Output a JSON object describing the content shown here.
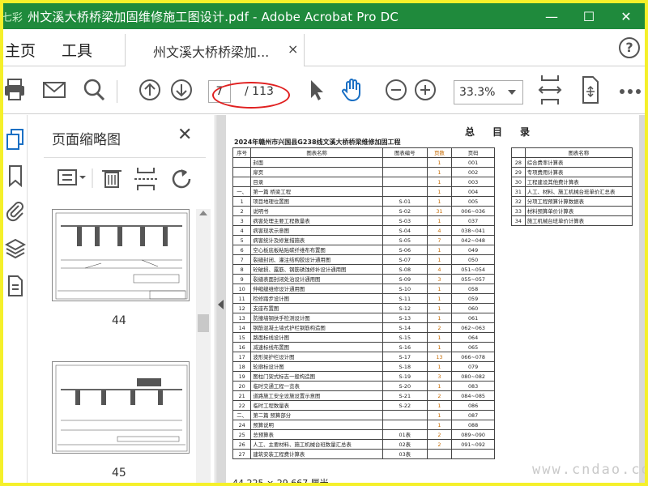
{
  "window": {
    "title": "州文溪大桥桥梁加固维修施工图设计.pdf - Adobe Acrobat Pro DC",
    "logo_text": "七彩",
    "controls": [
      "—",
      "☐",
      "✕"
    ]
  },
  "tabs": {
    "home": "主页",
    "tools": "工具",
    "document": "州文溪大桥桥梁加...",
    "document_close": "×",
    "help": "?"
  },
  "toolbar": {
    "current_page": "7",
    "total_pages": "/ 113",
    "zoom": "33.3%"
  },
  "thumbnails": {
    "title": "页面缩略图",
    "close": "✕",
    "pages": [
      {
        "label": "44"
      },
      {
        "label": "45"
      }
    ]
  },
  "document": {
    "title": "总目录",
    "subtitle": "2024年赣州市兴国县G238线文溪大桥桥梁维修加固工程",
    "left_headers": [
      "序号",
      "图表名称",
      "图表编号",
      "页数",
      "页码"
    ],
    "left_rows": [
      [
        "",
        "封面",
        "",
        "1",
        "001"
      ],
      [
        "",
        "扉页",
        "",
        "1",
        "002"
      ],
      [
        "",
        "目录",
        "",
        "1",
        "003"
      ],
      [
        "一、",
        "第一篇 桥梁工程",
        "",
        "1",
        "004"
      ],
      [
        "1",
        "项目地理位置图",
        "S-01",
        "1",
        "005"
      ],
      [
        "2",
        "说明书",
        "S-02",
        "31",
        "006~036"
      ],
      [
        "3",
        "病害处理主要工程数量表",
        "S-03",
        "1",
        "037"
      ],
      [
        "4",
        "病害现状示意图",
        "S-04",
        "4",
        "038~041"
      ],
      [
        "5",
        "病害统计及修复措施表",
        "S-05",
        "7",
        "042~048"
      ],
      [
        "6",
        "空心板底板粘贴碳纤维布布置图",
        "S-06",
        "1",
        "049"
      ],
      [
        "7",
        "裂缝封闭、灌注结构胶设计通用图",
        "S-07",
        "1",
        "050"
      ],
      [
        "8",
        "砼破损、露筋、钢筋锈蚀修补设计通用图",
        "S-08",
        "4",
        "051~054"
      ],
      [
        "9",
        "裂缝表面封闭处治设计通用图",
        "S-09",
        "3",
        "055~057"
      ],
      [
        "10",
        "伸缩缝维修设计通用图",
        "S-10",
        "1",
        "058"
      ],
      [
        "11",
        "检修踏步设计图",
        "S-11",
        "1",
        "059"
      ],
      [
        "12",
        "支座布置图",
        "S-12",
        "1",
        "060"
      ],
      [
        "13",
        "防撞墙钢扶手检测设计图",
        "S-13",
        "1",
        "061"
      ],
      [
        "14",
        "钢筋混凝土墙式护栏钢筋构造图",
        "S-14",
        "2",
        "062~063"
      ],
      [
        "15",
        "路面标线设计图",
        "S-15",
        "1",
        "064"
      ],
      [
        "16",
        "减速标线布置图",
        "S-16",
        "1",
        "065"
      ],
      [
        "17",
        "波形梁护栏设计图",
        "S-17",
        "13",
        "066~078"
      ],
      [
        "18",
        "轮廓标设计图",
        "S-18",
        "1",
        "079"
      ],
      [
        "19",
        "图柱门架式标志一般构造图",
        "S-19",
        "3",
        "080~082"
      ],
      [
        "20",
        "临时交通工程一览表",
        "S-20",
        "1",
        "083"
      ],
      [
        "21",
        "道路施工安全设施设置示意图",
        "S-21",
        "2",
        "084~085"
      ],
      [
        "22",
        "临时工程数量表",
        "S-22",
        "1",
        "086"
      ],
      [
        "二、",
        "第二篇 预算部分",
        "",
        "1",
        "087"
      ],
      [
        "24",
        "预算说明",
        "",
        "1",
        "088"
      ],
      [
        "25",
        "总预算表",
        "01表",
        "2",
        "089~090"
      ],
      [
        "26",
        "人工、主要材料、施工机械台班数量汇总表",
        "02表",
        "2",
        "091~092"
      ],
      [
        "27",
        "建筑安装工程费计算表",
        "03表",
        "",
        ""
      ]
    ],
    "right_headers": [
      "",
      "图表名称"
    ],
    "right_rows": [
      [
        "28",
        "综合费率计算表"
      ],
      [
        "29",
        "专项费用计算表"
      ],
      [
        "30",
        "工程建设其他费计算表"
      ],
      [
        "31",
        "人工、材料、施工机械台班单价汇总表"
      ],
      [
        "32",
        "分项工程预算计算数据表"
      ],
      [
        "33",
        "材料预算单价计算表"
      ],
      [
        "34",
        "施工机械台班单价计算表"
      ]
    ],
    "bottom_text": "44.225 × 29.667 厘米",
    "watermark": "www.cndao.com"
  }
}
